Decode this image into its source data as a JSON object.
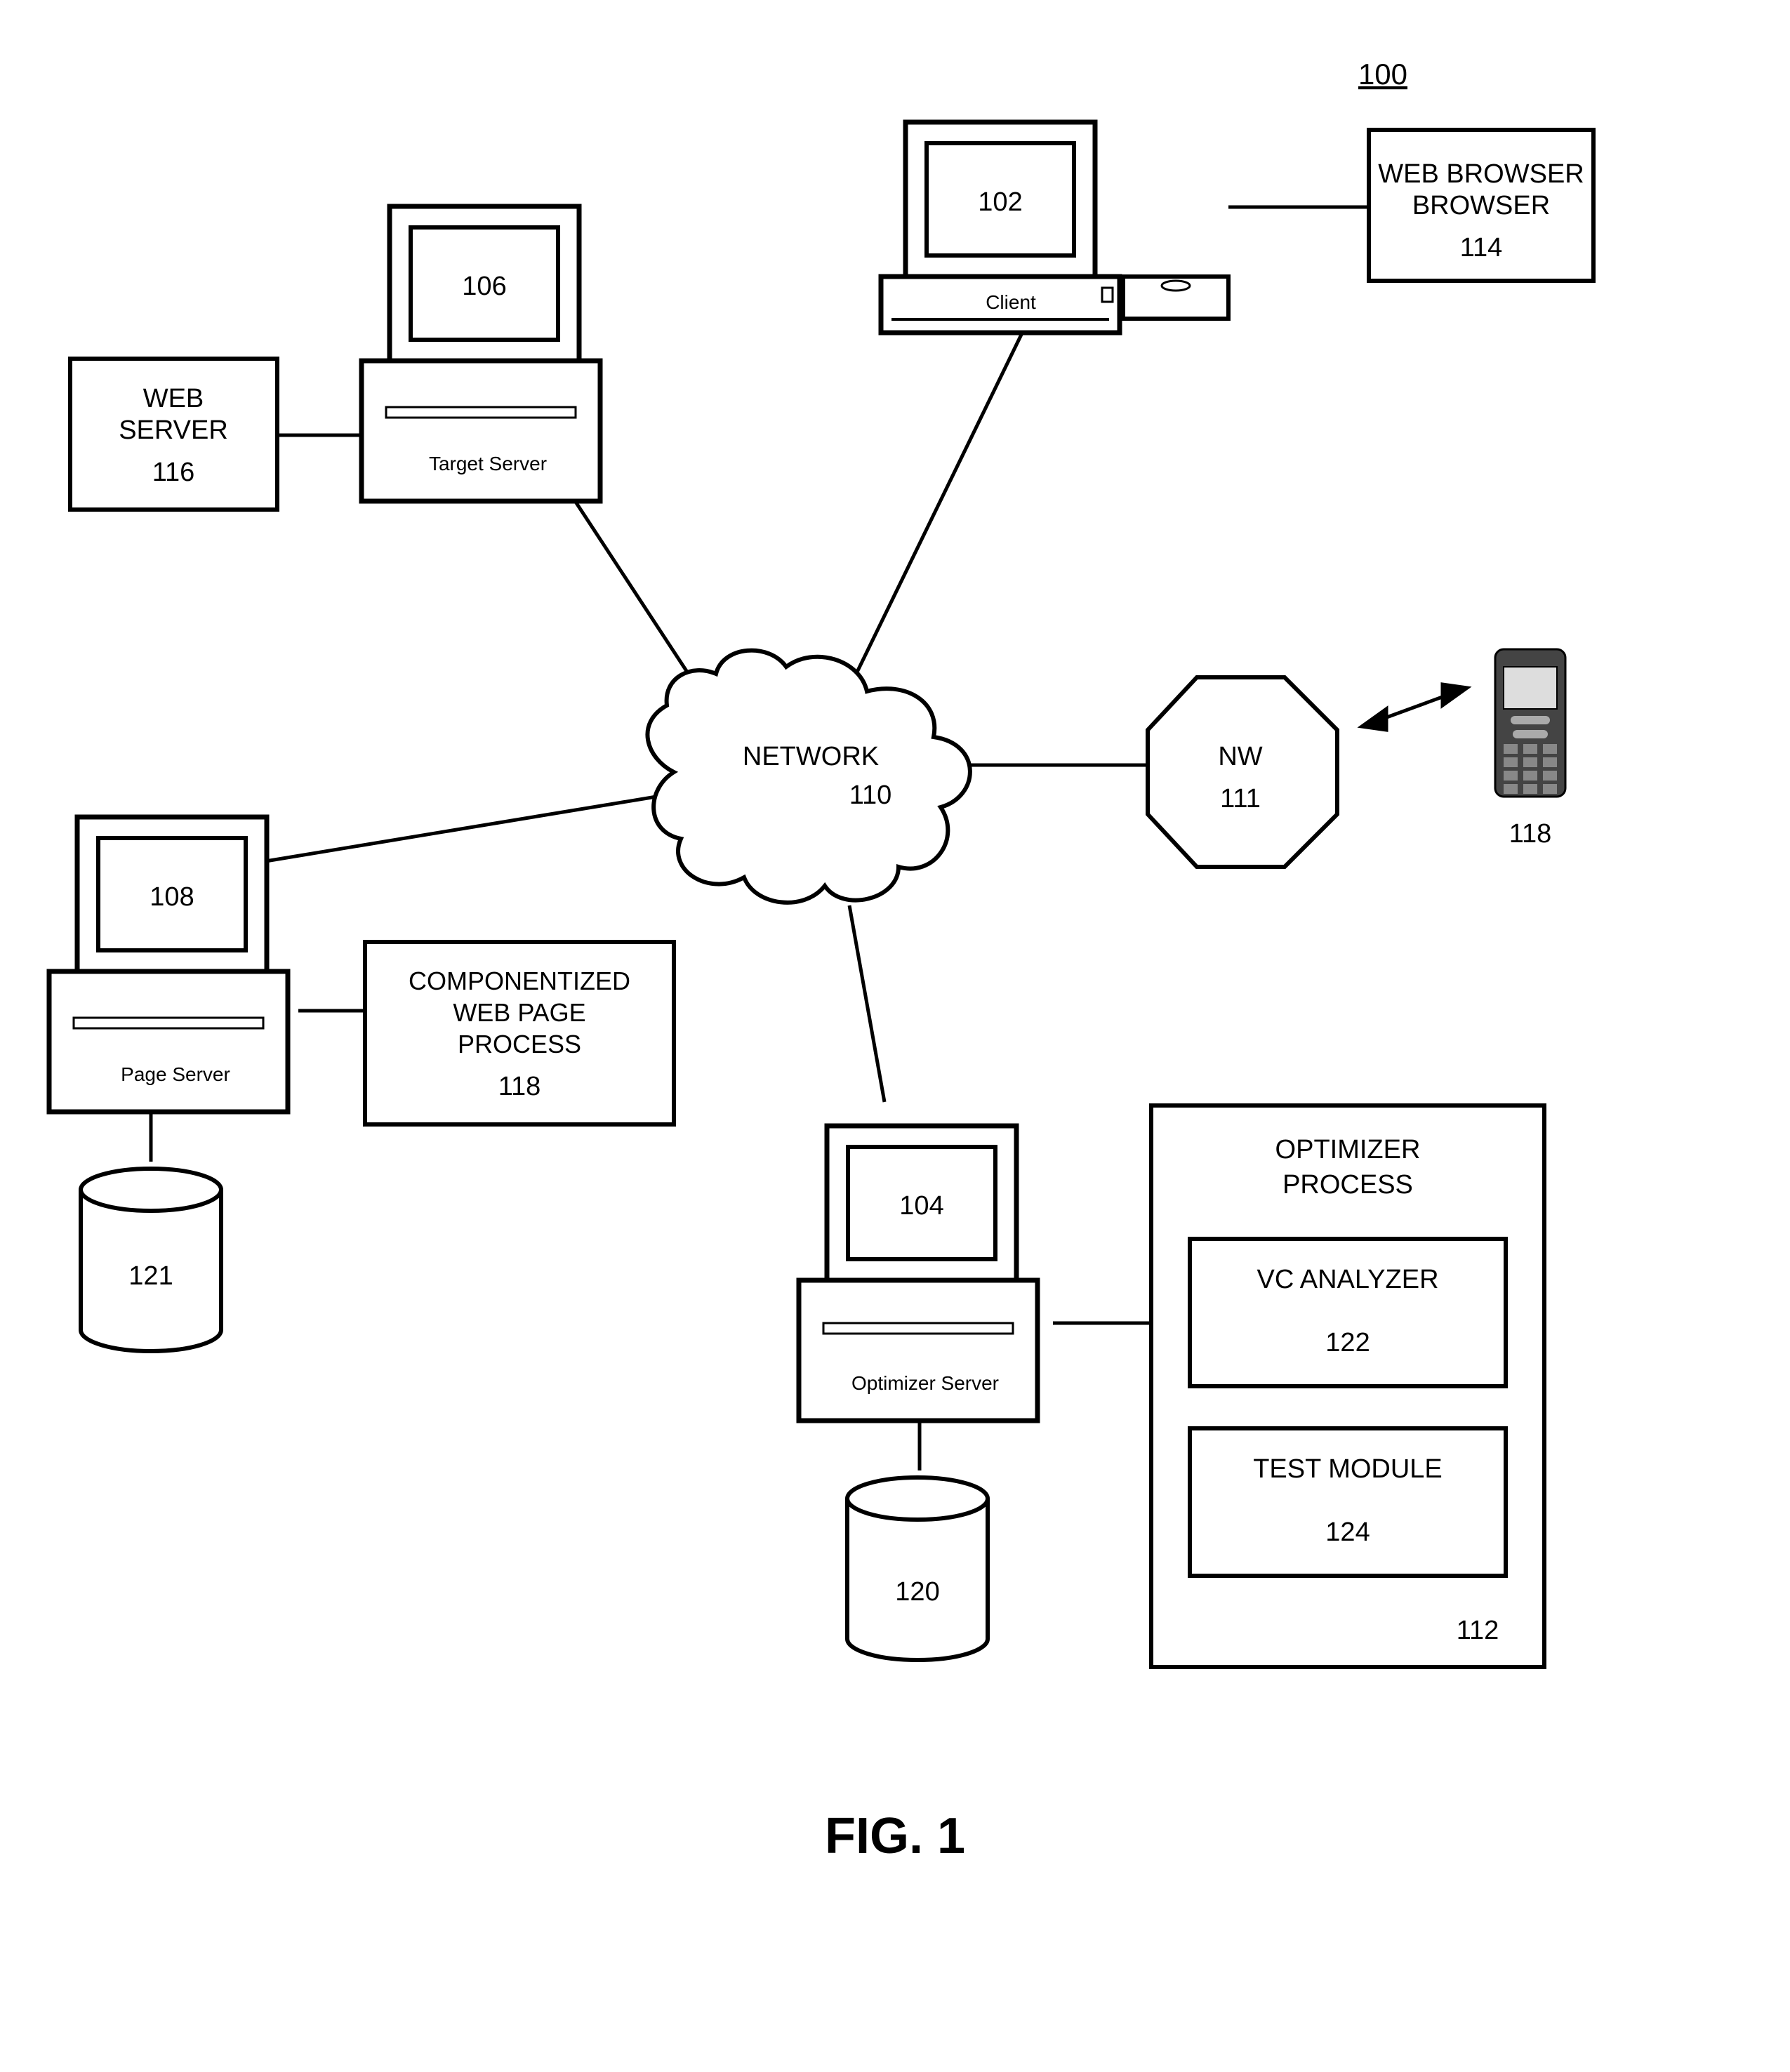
{
  "systemNumber": "100",
  "figureLabel": "FIG. 1",
  "nodes": {
    "client": {
      "id": "102",
      "caption": "Client"
    },
    "webBrowser": {
      "title": "WEB BROWSER",
      "id": "114"
    },
    "targetServer": {
      "id": "106",
      "caption": "Target Server"
    },
    "webServer": {
      "title": "WEB SERVER",
      "id": "116"
    },
    "optimizerServer": {
      "id": "104",
      "caption": "Optimizer Server"
    },
    "pageServer": {
      "id": "108",
      "caption": "Page Server"
    },
    "compWebPage": {
      "title1": "COMPONENTIZED",
      "title2": "WEB PAGE",
      "title3": "PROCESS",
      "id": "118"
    },
    "network": {
      "title": "NETWORK",
      "id": "110"
    },
    "nw": {
      "title": "NW",
      "id": "111"
    },
    "phone": {
      "id": "118"
    },
    "db1": {
      "id": "121"
    },
    "db2": {
      "id": "120"
    },
    "optimizerProcess": {
      "title": "OPTIMIZER PROCESS",
      "vc": {
        "title": "VC ANALYZER",
        "id": "122"
      },
      "tm": {
        "title": "TEST MODULE",
        "id": "124"
      },
      "id": "112"
    }
  }
}
